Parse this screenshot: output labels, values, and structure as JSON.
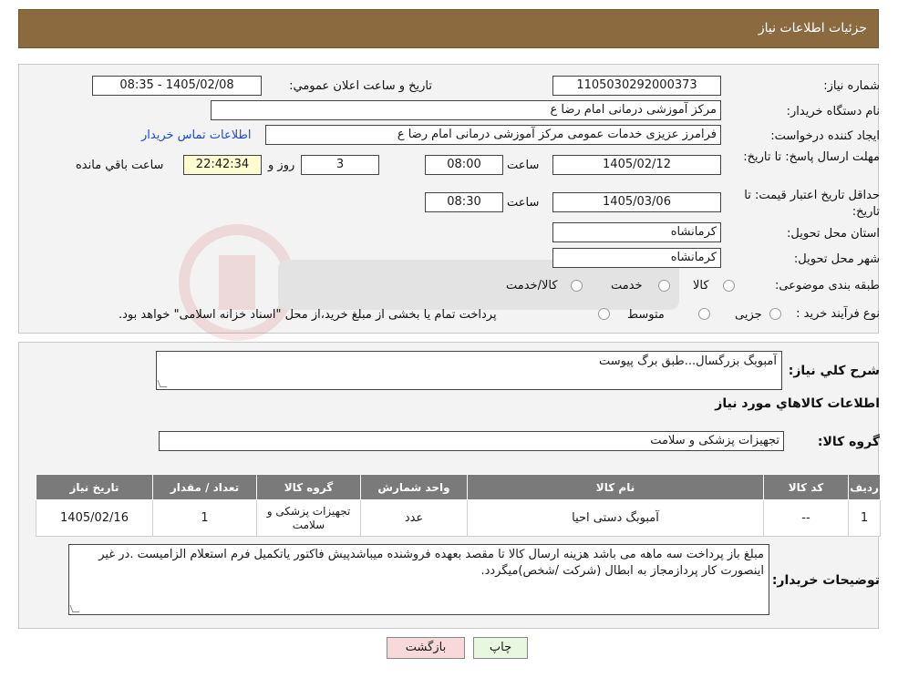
{
  "header": {
    "title": "جزئیات اطلاعات نیاز"
  },
  "form": {
    "need_number": {
      "label": "شماره نیاز:",
      "value": "1105030292000373"
    },
    "announce_datetime": {
      "label": "تاریخ و ساعت اعلان عمومي:",
      "value": "1405/02/08 - 08:35"
    },
    "buyer_org": {
      "label": "نام دستگاه خريدار:",
      "value": "مرکز آموزشی  درمانی امام رضا  ع"
    },
    "requester": {
      "label": "ايجاد کننده درخواست:",
      "value": "فرامرز عزیزی خدمات عمومی مرکز آموزشی  درمانی امام رضا  ع"
    },
    "buyer_contact_link": "اطلاعات تماس خریدار",
    "reply_deadline": {
      "label": "مهلت ارسال پاسخ: تا تاريخ:",
      "date": "1405/02/12",
      "time_label": "ساعت",
      "time": "08:00",
      "days": "3",
      "days_label": "روز و",
      "remaining": "22:42:34",
      "remaining_label": "ساعت باقي مانده"
    },
    "price_validity": {
      "label": "حداقل تاريخ اعتبار قيمت: تا تاريخ:",
      "date": "1405/03/06",
      "time_label": "ساعت",
      "time": "08:30"
    },
    "province": {
      "label": "استان محل تحويل:",
      "value": "کرمانشاه"
    },
    "city": {
      "label": "شهر محل تحويل:",
      "value": "کرمانشاه"
    },
    "category": {
      "label": "طبقه بندی موضوعی:",
      "options": [
        "کالا",
        "خدمت",
        "کالا/خدمت"
      ]
    },
    "process_type": {
      "label": "نوع فرآيند خريد :",
      "options": [
        "جزیی",
        "متوسط"
      ],
      "note": "پرداخت تمام يا بخشی از مبلغ خريد،از محل \"اسناد خزانه اسلامی\" خواهد بود."
    }
  },
  "details": {
    "summary_label": "شرح کلي نياز:",
    "summary_value": "آمبوبگ بزرگسال...طبق برگ پیوست",
    "goods_info_title": "اطلاعات کالاهاي مورد نياز",
    "goods_group_label": "گروه کالا:",
    "goods_group_value": "تجهیزات پزشکی و سلامت",
    "table": {
      "headers": [
        "رديف",
        "کد کالا",
        "نام کالا",
        "واحد شمارش",
        "گروه کالا",
        "تعداد / مقدار",
        "تاريخ نياز"
      ],
      "rows": [
        [
          "1",
          "--",
          "آمبوبگ دستی احیا",
          "عدد",
          "تجهیزات پزشکی و سلامت",
          "1",
          "1405/02/16"
        ]
      ]
    },
    "buyer_notes_label": "توضيحات خريدار:",
    "buyer_notes_value": "مبلغ باز پرداخت سه ماهه می باشد هزینه ارسال کالا تا مقصد بعهده فروشنده میباشدپیش فاکتور یاتکمیل فرم استعلام الزامیست .در غیر اینصورت کار پردازمجاز به ابطال (شرکت /شخص)میگردد."
  },
  "buttons": {
    "print": "چاپ",
    "back": "بازگشت"
  },
  "colors": {
    "header_bg": "#8a6a3e",
    "table_header_bg": "#7a7a7a",
    "remaining_bg": "#fffbd0",
    "back_btn_bg": "#f8d9d9",
    "print_btn_bg": "#e8f8e0"
  }
}
